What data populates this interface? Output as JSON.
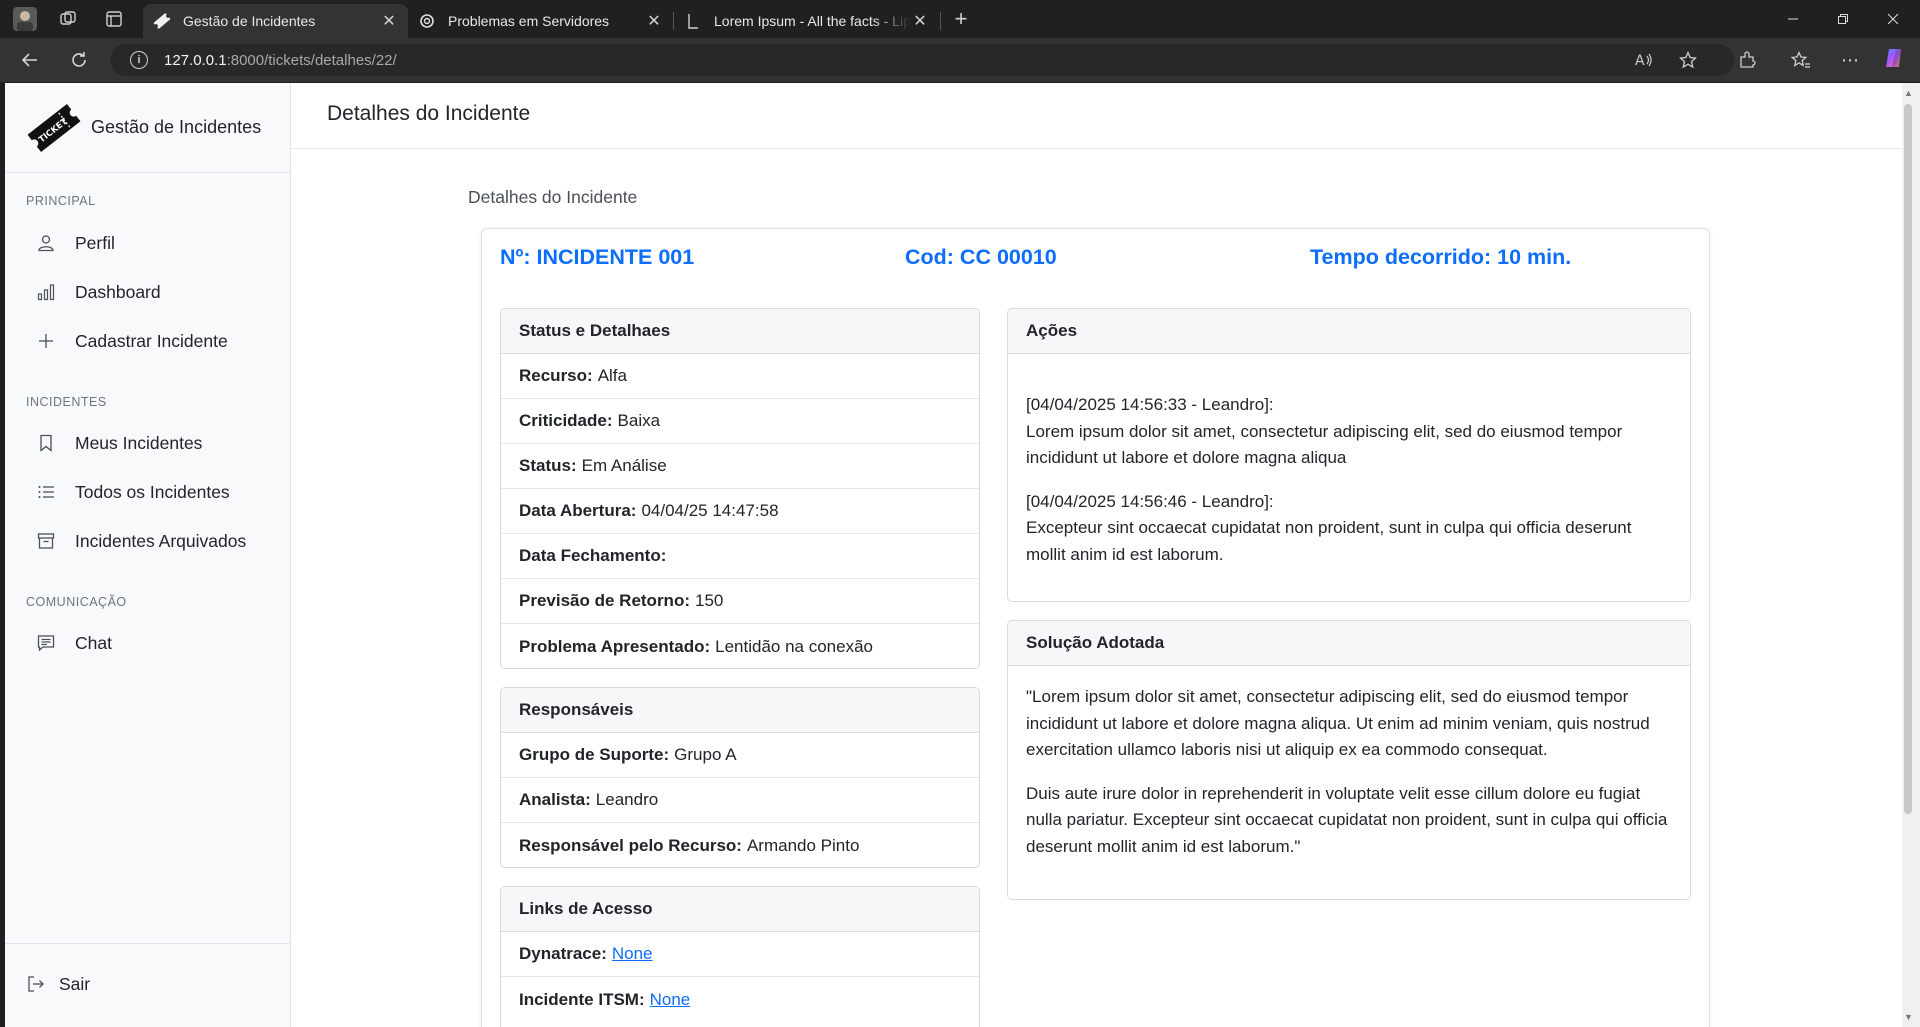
{
  "browser": {
    "tabs": [
      {
        "title": "Gestão de Incidentes",
        "icon": "ticket-icon",
        "active": true
      },
      {
        "title": "Problemas em Servidores",
        "icon": "openai-icon",
        "active": false
      },
      {
        "title": "Lorem Ipsum - All the facts - Lipsum",
        "icon": "lipsum-icon",
        "active": false
      }
    ],
    "url_host": "127.0.0.1",
    "url_path": ":8000/tickets/detalhes/22/"
  },
  "sidebar": {
    "brand": "Gestão de Incidentes",
    "logo_text": "TICKET",
    "sections": {
      "principal": "PRINCIPAL",
      "incidentes": "INCIDENTES",
      "comunicacao": "COMUNICAÇÃO"
    },
    "items": {
      "perfil": "Perfil",
      "dashboard": "Dashboard",
      "cadastrar": "Cadastrar Incidente",
      "meus": "Meus Incidentes",
      "todos": "Todos os Incidentes",
      "arquivados": "Incidentes Arquivados",
      "chat": "Chat",
      "sair": "Sair"
    }
  },
  "topbar": {
    "title": "Detalhes do Incidente"
  },
  "breadcrumb": "Detalhes do Incidente",
  "incident": {
    "numero": "Nº: INCIDENTE 001",
    "codigo": "Cod: CC 00010",
    "tempo": "Tempo decorrido: 10 min."
  },
  "status_panel": {
    "title": "Status e Detalhaes",
    "rows": [
      {
        "label": "Recurso:",
        "value": "Alfa"
      },
      {
        "label": "Criticidade:",
        "value": "Baixa"
      },
      {
        "label": "Status:",
        "value": "Em Análise"
      },
      {
        "label": "Data Abertura:",
        "value": "04/04/25 14:47:58"
      },
      {
        "label": "Data Fechamento:",
        "value": ""
      },
      {
        "label": "Previsão de Retorno:",
        "value": "150"
      },
      {
        "label": "Problema Apresentado:",
        "value": "Lentidão na conexão"
      }
    ]
  },
  "responsaveis_panel": {
    "title": "Responsáveis",
    "rows": [
      {
        "label": "Grupo de Suporte:",
        "value": "Grupo A"
      },
      {
        "label": "Analista:",
        "value": "Leandro"
      },
      {
        "label": "Responsável pelo Recurso:",
        "value": "Armando Pinto"
      }
    ]
  },
  "links_panel": {
    "title": "Links de Acesso",
    "rows": [
      {
        "label": "Dynatrace:",
        "value": "None"
      },
      {
        "label": "Incidente ITSM:",
        "value": "None"
      }
    ]
  },
  "acoes_panel": {
    "title": "Ações",
    "entries": [
      {
        "meta": "[04/04/2025 14:56:33 - Leandro]:",
        "text": "Lorem ipsum dolor sit amet, consectetur adipiscing elit, sed do eiusmod tempor incididunt ut labore et dolore magna aliqua"
      },
      {
        "meta": "[04/04/2025 14:56:46 - Leandro]:",
        "text": "Excepteur sint occaecat cupidatat non proident, sunt in culpa qui officia deserunt mollit anim id est laborum."
      }
    ]
  },
  "solucao_panel": {
    "title": "Solução Adotada",
    "paragraphs": [
      "\"Lorem ipsum dolor sit amet, consectetur adipiscing elit, sed do eiusmod tempor incididunt ut labore et dolore magna aliqua. Ut enim ad minim veniam, quis nostrud exercitation ullamco laboris nisi ut aliquip ex ea commodo consequat.",
      "Duis aute irure dolor in reprehenderit in voluptate velit esse cillum dolore eu fugiat nulla pariatur. Excepteur sint occaecat cupidatat non proident, sunt in culpa qui officia deserunt mollit anim id est laborum.\""
    ]
  },
  "colors": {
    "accent": "#0d6efd",
    "sidebar_bg": "#f8f9fa",
    "chrome_bg": "#202020"
  }
}
